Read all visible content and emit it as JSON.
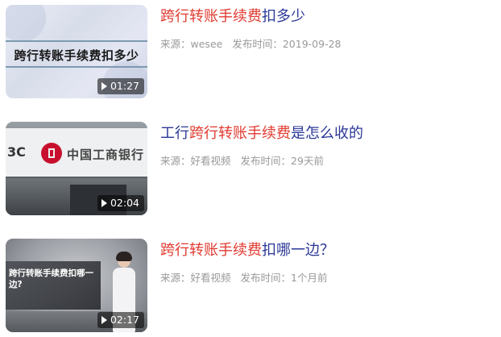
{
  "results": [
    {
      "title_prefix": "",
      "title_highlight": "跨行转账手续费",
      "title_suffix": "扣多少",
      "source_label": "来源：",
      "source": "wesee",
      "time_label": "发布时间：",
      "time": "2019-09-28",
      "duration": "01:27",
      "thumb_caption": "跨行转账手续费扣多少"
    },
    {
      "title_prefix": "工行",
      "title_highlight": "跨行转账手续费",
      "title_suffix": "是怎么收的",
      "source_label": "来源：",
      "source": "好看视频",
      "time_label": "发布时间：",
      "time": "29天前",
      "duration": "02:04",
      "thumb_bc": "3C",
      "thumb_bank": "中国工商银行"
    },
    {
      "title_prefix": "",
      "title_highlight": "跨行转账手续费",
      "title_suffix": "扣哪一边？",
      "source_label": "来源：",
      "source": "好看视频",
      "time_label": "发布时间：",
      "time": "1个月前",
      "duration": "02:17",
      "thumb_caption": "跨行转账手续费扣哪一边?"
    }
  ],
  "colors": {
    "title": "#2b3796",
    "highlight": "#e03a2f",
    "meta": "#999999"
  }
}
